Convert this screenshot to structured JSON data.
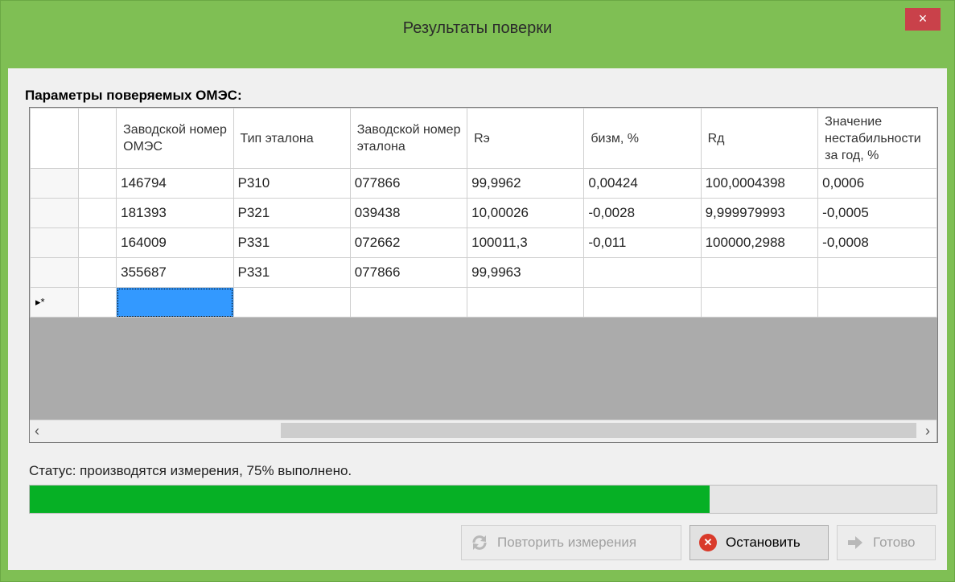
{
  "window": {
    "title": "Результаты поверки",
    "close_glyph": "×"
  },
  "section_label": "Параметры поверяемых ОМЭС:",
  "grid": {
    "columns": [
      "Заводской номер ОМЭС",
      "Тип эталона",
      "Заводской номер эталона",
      "Rэ",
      "бизм, %",
      "Rд",
      "Значение нестабильности за год, %"
    ],
    "rows": [
      [
        "146794",
        "P310",
        "077866",
        "99,9962",
        "0,00424",
        "100,0004398",
        "0,0006"
      ],
      [
        "181393",
        "P321",
        "039438",
        "10,00026",
        "-0,0028",
        "9,999979993",
        "-0,0005"
      ],
      [
        "164009",
        "P331",
        "072662",
        "100011,3",
        "-0,011",
        "100000,2988",
        "-0,0008"
      ],
      [
        "355687",
        "P331",
        "077866",
        "99,9963",
        "",
        "",
        ""
      ]
    ],
    "new_row_marker": "▸*"
  },
  "scrollbar": {
    "left_arrow": "‹",
    "right_arrow": "›"
  },
  "status_text": "Статус: производятся измерения, 75% выполнено.",
  "progress": {
    "percent": 75,
    "color": "#06b025"
  },
  "buttons": {
    "repeat": {
      "label": "Повторить измерения",
      "enabled": false,
      "icon": "refresh-icon"
    },
    "stop": {
      "label": "Остановить",
      "enabled": true,
      "icon": "stop-icon"
    },
    "done": {
      "label": "Готово",
      "enabled": false,
      "icon": "arrow-right-icon"
    }
  },
  "colors": {
    "title_bar": "#7fbf54",
    "close_button": "#c9414a",
    "progress_fill": "#06b025",
    "selection": "#3399ff"
  }
}
